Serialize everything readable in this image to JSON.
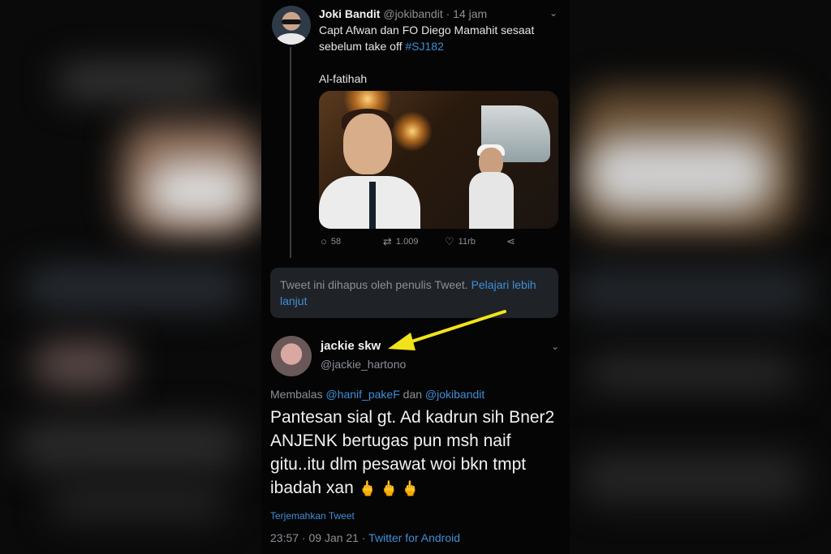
{
  "tweet1": {
    "author_name": "Joki Bandit",
    "author_handle": "@jokibandit",
    "time": "· 14 jam",
    "text": "Capt Afwan dan FO Diego Mamahit sesaat sebelum take off",
    "hashtag": "#SJ182",
    "text2": "Al-fatihah",
    "replies": "58",
    "retweets": "1.009",
    "likes": "11rb"
  },
  "deleted_notice": {
    "text": "Tweet ini dihapus oleh penulis Tweet.",
    "link": "Pelajari lebih lanjut"
  },
  "tweet2": {
    "author_name": "jackie skw",
    "author_handle": "@jackie_hartono",
    "reply_prefix": "Membalas",
    "reply_to1": "@hanif_pakeF",
    "reply_joiner": "dan",
    "reply_to2": "@jokibandit",
    "text": "Pantesan sial gt. Ad kadrun sih Bner2 ANJENK bertugas pun msh naif gitu..itu dlm pesawat woi bkn tmpt ibadah xan",
    "emojis": "🖕🖕🖕",
    "translate": "Terjemahkan Tweet",
    "timestamp": "23:57 · 09 Jan 21 ·",
    "source": "Twitter for Android"
  },
  "icons": {
    "reply": "reply-icon",
    "retweet": "retweet-icon",
    "like": "heart-icon",
    "share": "share-icon",
    "more": "chevron-down-icon",
    "annotation": "yellow-arrow"
  },
  "colors": {
    "background": "#050505",
    "link": "#3f8ed6",
    "muted": "#8b9096",
    "arrow": "#f2e21a"
  }
}
